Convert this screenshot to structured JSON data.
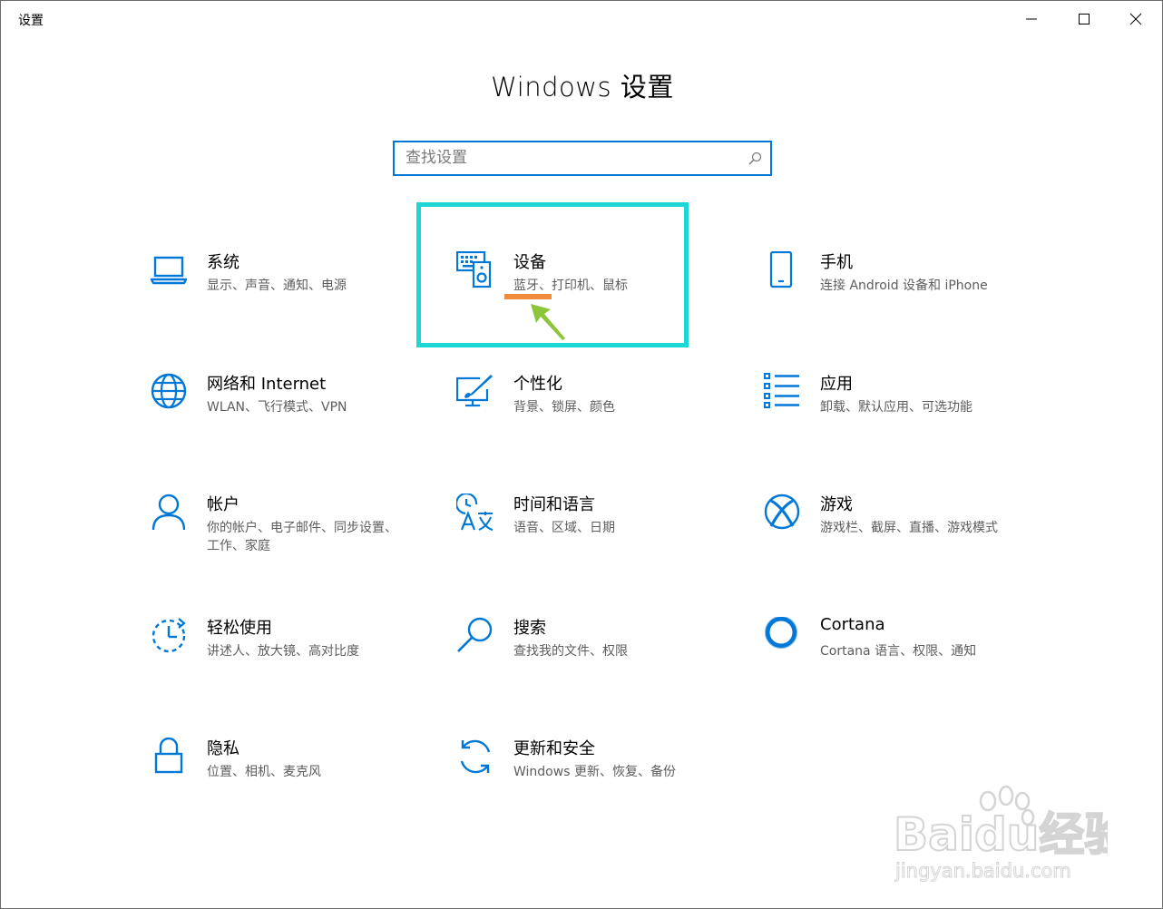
{
  "window": {
    "title": "设置",
    "controls": {
      "minimize_icon": "minimize-icon",
      "maximize_icon": "maximize-icon",
      "close_icon": "close-icon"
    }
  },
  "header": {
    "title": "Windows 设置"
  },
  "search": {
    "placeholder": "查找设置",
    "value": ""
  },
  "colors": {
    "accent": "#0078d7",
    "highlight": "#1dd7d7",
    "underline": "#f08a3c",
    "arrow": "#8cc43a"
  },
  "tiles": [
    {
      "title": "系统",
      "desc": "显示、声音、通知、电源",
      "icon": "laptop-icon"
    },
    {
      "title": "设备",
      "desc": "蓝牙、打印机、鼠标",
      "icon": "devices-icon"
    },
    {
      "title": "手机",
      "desc": "连接 Android 设备和 iPhone",
      "icon": "phone-icon"
    },
    {
      "title": "网络和 Internet",
      "desc": "WLAN、飞行模式、VPN",
      "icon": "globe-icon"
    },
    {
      "title": "个性化",
      "desc": "背景、锁屏、颜色",
      "icon": "personalization-icon"
    },
    {
      "title": "应用",
      "desc": "卸载、默认应用、可选功能",
      "icon": "apps-list-icon"
    },
    {
      "title": "帐户",
      "desc": "你的帐户、电子邮件、同步设置、工作、家庭",
      "icon": "person-icon"
    },
    {
      "title": "时间和语言",
      "desc": "语音、区域、日期",
      "icon": "time-language-icon"
    },
    {
      "title": "游戏",
      "desc": "游戏栏、截屏、直播、游戏模式",
      "icon": "xbox-icon"
    },
    {
      "title": "轻松使用",
      "desc": "讲述人、放大镜、高对比度",
      "icon": "ease-of-access-icon"
    },
    {
      "title": "搜索",
      "desc": "查找我的文件、权限",
      "icon": "magnifier-icon"
    },
    {
      "title": "Cortana",
      "desc": "Cortana 语言、权限、通知",
      "icon": "cortana-circle-icon"
    },
    {
      "title": "隐私",
      "desc": "位置、相机、麦克风",
      "icon": "lock-icon"
    },
    {
      "title": "更新和安全",
      "desc": "Windows 更新、恢复、备份",
      "icon": "sync-arrows-icon"
    }
  ],
  "watermark": {
    "brand": "Baidu经验",
    "url": "jingyan.baidu.com"
  }
}
